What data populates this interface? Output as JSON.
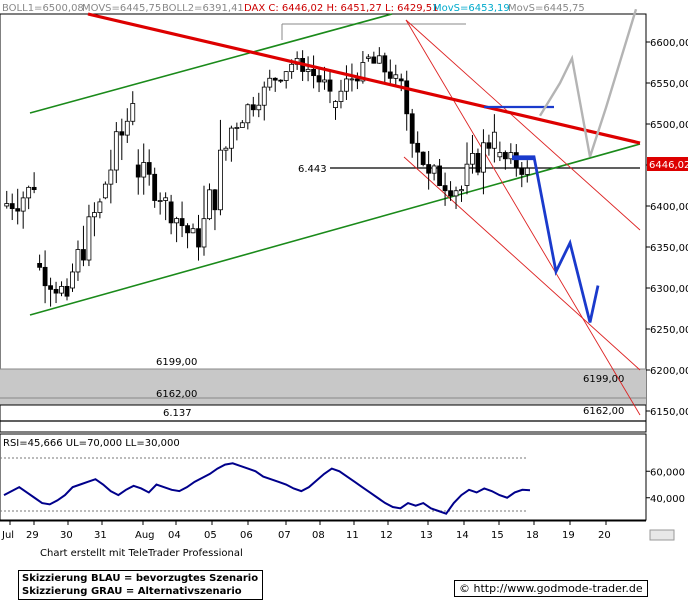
{
  "header": {
    "boll1": "BOLL1=6500,08",
    "movs1": "MOVS=6445,75",
    "boll2": "BOLL2=6391,41",
    "dax": "DAX C: 6446,02 H: 6451,27 L: 6429,51",
    "movs2": "MovS=6453,19",
    "movs3": "MovS=6445,75"
  },
  "labels": {
    "level_6443": "6.443",
    "level_6199_left": "6199,00",
    "level_6162_left": "6162,00",
    "level_6137": "6.137",
    "level_6199_right": "6199,00",
    "level_6162_right": "6162,00",
    "current_price": "6446,02",
    "rsi_header": "RSI=45,666 UL=70,000 LL=30,000",
    "created_by": "Chart erstellt mit TeleTrader Professional",
    "legend_blue": "Skizzierung BLAU = bevorzugtes Szenario",
    "legend_gray": "Skizzierung GRAU = Alternativszenario",
    "url": "© http://www.godmode-trader.de"
  },
  "colors": {
    "candle_up": "#ffffff",
    "candle_down": "#000000",
    "channel": "#1a8a1a",
    "resistance": "#dd0000",
    "scenario_blue": "#1a3acc",
    "scenario_gray": "#b4b4b4",
    "rsi_line": "#00008b",
    "zone_fill": "#c8c8c8"
  },
  "chart_data": [
    {
      "type": "candlestick",
      "title": "DAX",
      "y_ticks": [
        "6600,00",
        "6550,00",
        "6500,00",
        "6450,00",
        "6400,00",
        "6350,00",
        "6300,00",
        "6250,00",
        "6200,00",
        "6150,00"
      ],
      "x_ticks": [
        "Jul",
        "29",
        "30",
        "31",
        "Aug",
        "04",
        "05",
        "06",
        "07",
        "08",
        "11",
        "12",
        "13",
        "14",
        "15",
        "18",
        "19",
        "20"
      ],
      "ylim": [
        6140,
        6640
      ],
      "levels": [
        6443,
        6199,
        6162,
        6137
      ],
      "last_close": 6446.02,
      "daily_ohlc": [
        {
          "x": "28",
          "o": 6400,
          "h": 6450,
          "l": 6340,
          "c": 6420
        },
        {
          "x": "29",
          "o": 6330,
          "h": 6350,
          "l": 6262,
          "c": 6290
        },
        {
          "x": "30",
          "o": 6300,
          "h": 6420,
          "l": 6295,
          "c": 6405
        },
        {
          "x": "31",
          "o": 6410,
          "h": 6540,
          "l": 6395,
          "c": 6525
        },
        {
          "x": "01",
          "o": 6450,
          "h": 6480,
          "l": 6380,
          "c": 6410
        },
        {
          "x": "04",
          "o": 6405,
          "h": 6425,
          "l": 6330,
          "c": 6350
        },
        {
          "x": "05",
          "o": 6350,
          "h": 6505,
          "l": 6320,
          "c": 6495
        },
        {
          "x": "06",
          "o": 6495,
          "h": 6560,
          "l": 6480,
          "c": 6545
        },
        {
          "x": "07",
          "o": 6545,
          "h": 6595,
          "l": 6530,
          "c": 6580
        },
        {
          "x": "08",
          "o": 6580,
          "h": 6590,
          "l": 6520,
          "c": 6540
        },
        {
          "x": "11",
          "o": 6520,
          "h": 6590,
          "l": 6505,
          "c": 6575
        },
        {
          "x": "12",
          "o": 6580,
          "h": 6622,
          "l": 6540,
          "c": 6560
        },
        {
          "x": "13",
          "o": 6555,
          "h": 6565,
          "l": 6420,
          "c": 6440
        },
        {
          "x": "14",
          "o": 6440,
          "h": 6460,
          "l": 6373,
          "c": 6420
        },
        {
          "x": "15",
          "o": 6425,
          "h": 6512,
          "l": 6400,
          "c": 6490
        },
        {
          "x": "18",
          "o": 6460,
          "h": 6480,
          "l": 6405,
          "c": 6446.02
        }
      ],
      "scenario_blue": [
        6460,
        6460,
        6320,
        6355,
        6258,
        6303
      ],
      "scenario_gray": [
        6510,
        6550,
        6580,
        6460,
        6520,
        6640
      ]
    },
    {
      "type": "line",
      "title": "RSI",
      "y_ticks": [
        "60,000",
        "40,000"
      ],
      "ylim": [
        20,
        80
      ],
      "upper": 70,
      "lower": 30,
      "last": 45.666,
      "values": [
        42,
        45,
        48,
        44,
        40,
        36,
        35,
        38,
        42,
        48,
        50,
        52,
        54,
        50,
        45,
        42,
        46,
        49,
        47,
        44,
        50,
        48,
        46,
        45,
        48,
        52,
        55,
        58,
        62,
        65,
        66,
        64,
        62,
        60,
        56,
        54,
        52,
        50,
        47,
        45,
        48,
        53,
        58,
        62,
        60,
        56,
        52,
        48,
        44,
        40,
        36,
        33,
        32,
        36,
        34,
        36,
        32,
        30,
        28,
        36,
        42,
        46,
        44,
        47,
        45,
        42,
        40,
        44,
        46,
        45.666
      ]
    }
  ]
}
